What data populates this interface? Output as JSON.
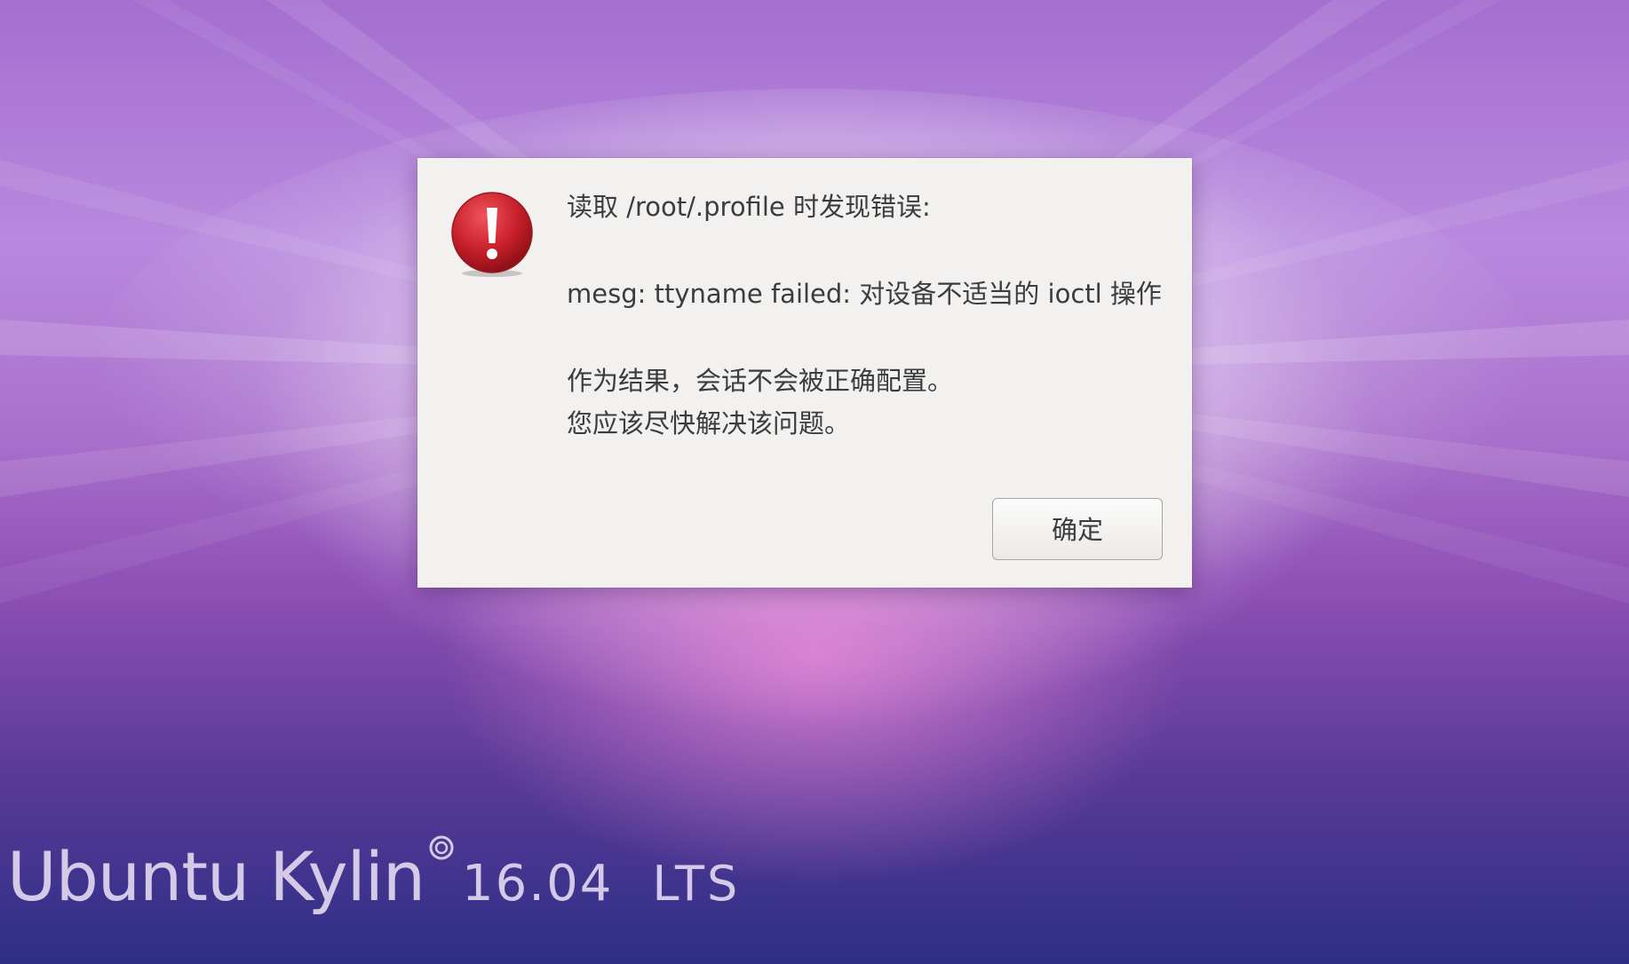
{
  "dialog": {
    "icon": "error-exclamation-icon",
    "heading": "读取 /root/.profile 时发现错误:",
    "error_line": "mesg: ttyname failed: 对设备不适当的 ioctl 操作",
    "consequence_line_1": "作为结果，会话不会被正确配置。",
    "consequence_line_2": "您应该尽快解决该问题。",
    "ok_label": "确定"
  },
  "brand": {
    "name": "Ubuntu Kylin",
    "registered_icon": "registered-mark-icon",
    "version": "16.04",
    "edition": "LTS"
  },
  "colors": {
    "dialog_bg": "#f2f1f0",
    "error_red": "#c8202a",
    "text": "#3c3c3c"
  }
}
